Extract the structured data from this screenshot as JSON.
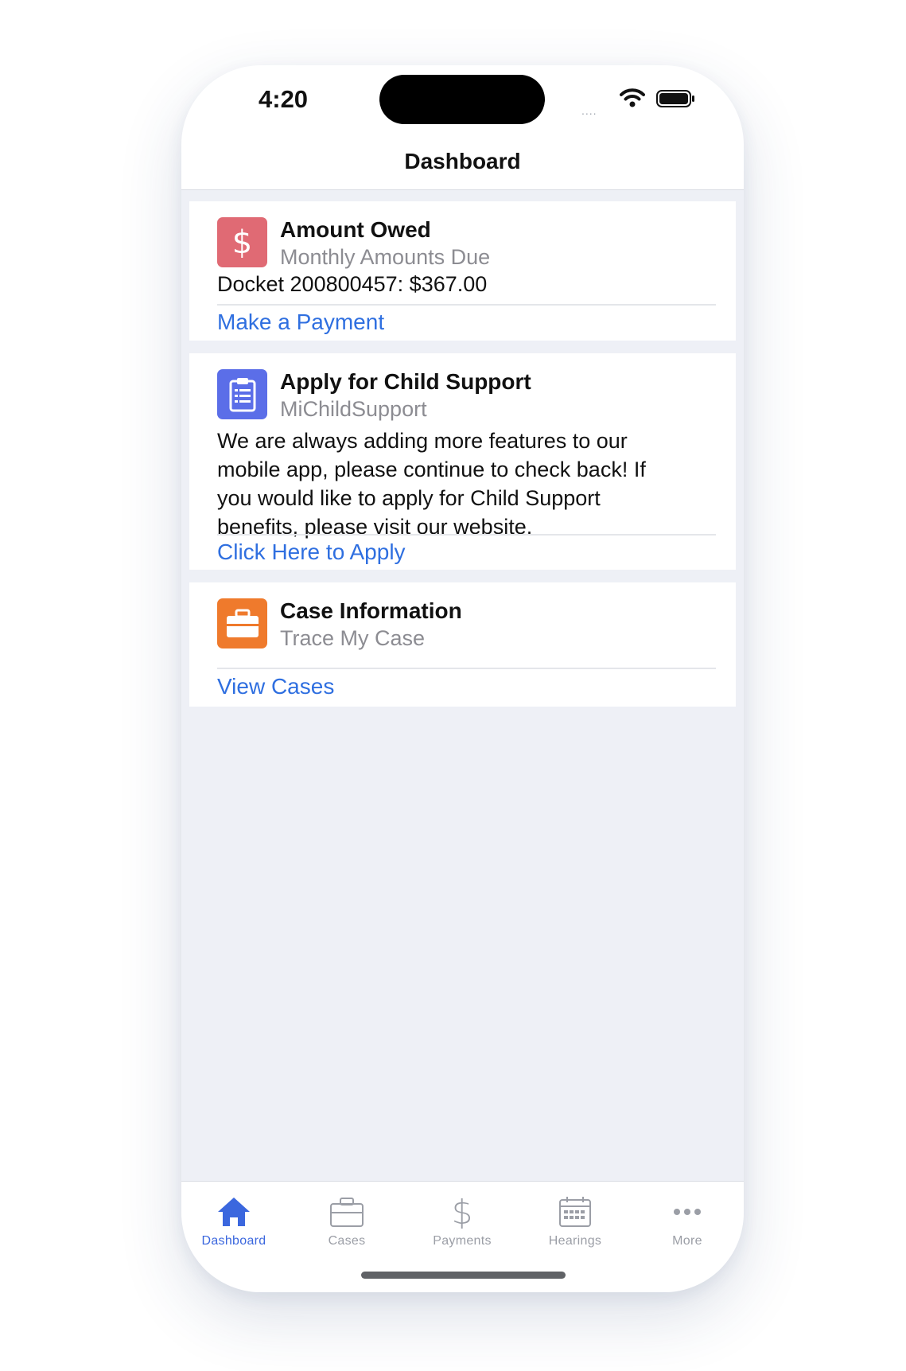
{
  "status_bar": {
    "time": "4:20",
    "signal": "....",
    "wifi_icon": "wifi-icon",
    "battery_icon": "battery-icon"
  },
  "nav": {
    "title": "Dashboard"
  },
  "cards": [
    {
      "icon": "dollar-icon",
      "icon_color": "#e06a74",
      "title": "Amount Owed",
      "subtitle": "Monthly Amounts Due",
      "body": "Docket 200800457: $367.00",
      "link": "Make a Payment"
    },
    {
      "icon": "clipboard-icon",
      "icon_color": "#5b6ee8",
      "title": "Apply for Child Support",
      "subtitle": "MiChildSupport",
      "body_lines": [
        "We are always adding more features to our",
        "mobile app, please continue to check back! If",
        "you would like to apply for Child Support",
        "benefits, please visit our website."
      ],
      "link": "Click Here to Apply"
    },
    {
      "icon": "briefcase-icon",
      "icon_color": "#ef7a2c",
      "title": "Case Information",
      "subtitle": "Trace My Case",
      "link": "View Cases"
    }
  ],
  "tabs": [
    {
      "label": "Dashboard",
      "icon": "home-icon",
      "active": true
    },
    {
      "label": "Cases",
      "icon": "briefcase-icon",
      "active": false
    },
    {
      "label": "Payments",
      "icon": "dollar-icon",
      "active": false
    },
    {
      "label": "Hearings",
      "icon": "calendar-icon",
      "active": false
    },
    {
      "label": "More",
      "icon": "more-icon",
      "active": false
    }
  ],
  "colors": {
    "link": "#2f6fe0",
    "active_tab": "#3b67de",
    "inactive_tab": "#9b9ea6",
    "background": "#eef0f6"
  }
}
